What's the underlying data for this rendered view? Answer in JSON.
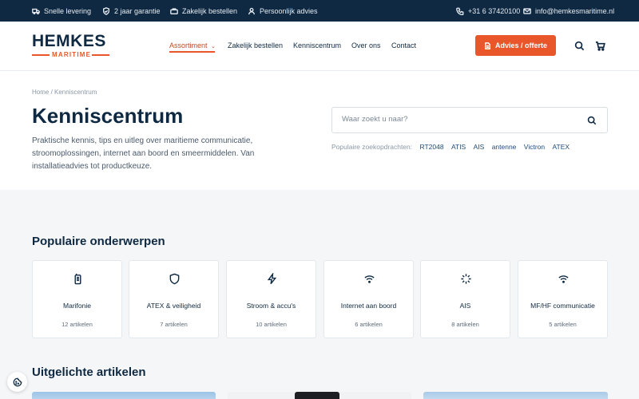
{
  "topbar": {
    "items": [
      "Snelle levering",
      "2 jaar garantie",
      "Zakelijk bestellen",
      "Persoonlijk advies"
    ],
    "phone": "+31 6 37420100",
    "email": "info@hemkesmaritime.nl"
  },
  "header": {
    "logo_main": "HEMKES",
    "logo_sub": "MARITIME",
    "nav": [
      "Assortiment",
      "Zakelijk bestellen",
      "Kenniscentrum",
      "Over ons",
      "Contact"
    ],
    "cta_label": "Advies / offerte"
  },
  "hero": {
    "breadcrumb": "Home / Kenniscentrum",
    "title": "Kenniscentrum",
    "intro": "Praktische kennis, tips en uitleg over maritieme communicatie, stroomoplossingen, internet aan boord en smeermiddelen. Van installatieadvies tot productkeuze.",
    "search_placeholder": "Waar zoekt u naar?",
    "popular_label": "Populaire zoekopdrachten:",
    "popular_tags": [
      "RT2048",
      "ATIS",
      "AIS",
      "antenne",
      "Victron",
      "ATEX"
    ]
  },
  "topics": {
    "title": "Populaire onderwerpen",
    "cards": [
      {
        "title": "Marifonie",
        "count": "12 artikelen",
        "icon": "radio-icon"
      },
      {
        "title": "ATEX & veiligheid",
        "count": "7 artikelen",
        "icon": "shield-icon"
      },
      {
        "title": "Stroom & accu's",
        "count": "10 artikelen",
        "icon": "lightning-icon"
      },
      {
        "title": "Internet aan boord",
        "count": "6 artikelen",
        "icon": "wifi-icon"
      },
      {
        "title": "AIS",
        "count": "8 artikelen",
        "icon": "signal-icon"
      },
      {
        "title": "MF/HF communicatie",
        "count": "5 artikelen",
        "icon": "wifi-icon"
      }
    ]
  },
  "featured": {
    "title": "Uitgelichte artikelen"
  },
  "colors": {
    "navy": "#0f2942",
    "accent": "#e8562a"
  }
}
